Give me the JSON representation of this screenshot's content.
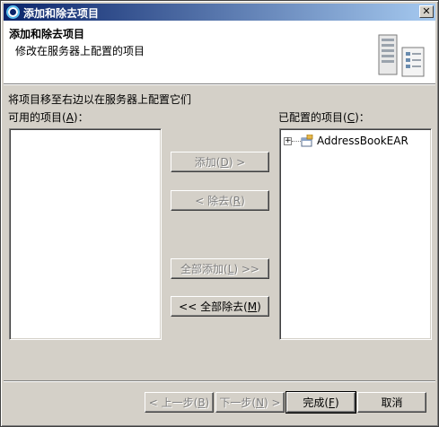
{
  "window": {
    "title": "添加和除去项目",
    "close_glyph": "✕"
  },
  "header": {
    "title": "添加和除去项目",
    "description": "修改在服务器上配置的项目",
    "icon": "server-icon"
  },
  "main": {
    "instruction": "将项目移至右边以在服务器上配置它们",
    "available": {
      "label_prefix": "可用的项目(",
      "mnemonic": "A",
      "label_suffix": ")："
    },
    "configured": {
      "label_prefix": "已配置的项目(",
      "mnemonic": "C",
      "label_suffix": ")：",
      "items": [
        {
          "label": "AddressBookEAR",
          "icon": "ear-project-icon",
          "expander": "+"
        }
      ]
    },
    "buttons": {
      "add": {
        "prefix": "添加(",
        "mnemonic": "D",
        "suffix": ") >"
      },
      "remove": {
        "prefix": "< 除去(",
        "mnemonic": "R",
        "suffix": ")"
      },
      "add_all": {
        "prefix": "全部添加(",
        "mnemonic": "L",
        "suffix": ") >>"
      },
      "remove_all": {
        "prefix": "<< 全部除去(",
        "mnemonic": "M",
        "suffix": ")"
      }
    }
  },
  "footer": {
    "back": {
      "prefix": "< 上一步(",
      "mnemonic": "B",
      "suffix": ")"
    },
    "next": {
      "prefix": "下一步(",
      "mnemonic": "N",
      "suffix": ") >"
    },
    "finish": {
      "prefix": "完成(",
      "mnemonic": "F",
      "suffix": ")"
    },
    "cancel": {
      "label": "取消"
    }
  }
}
